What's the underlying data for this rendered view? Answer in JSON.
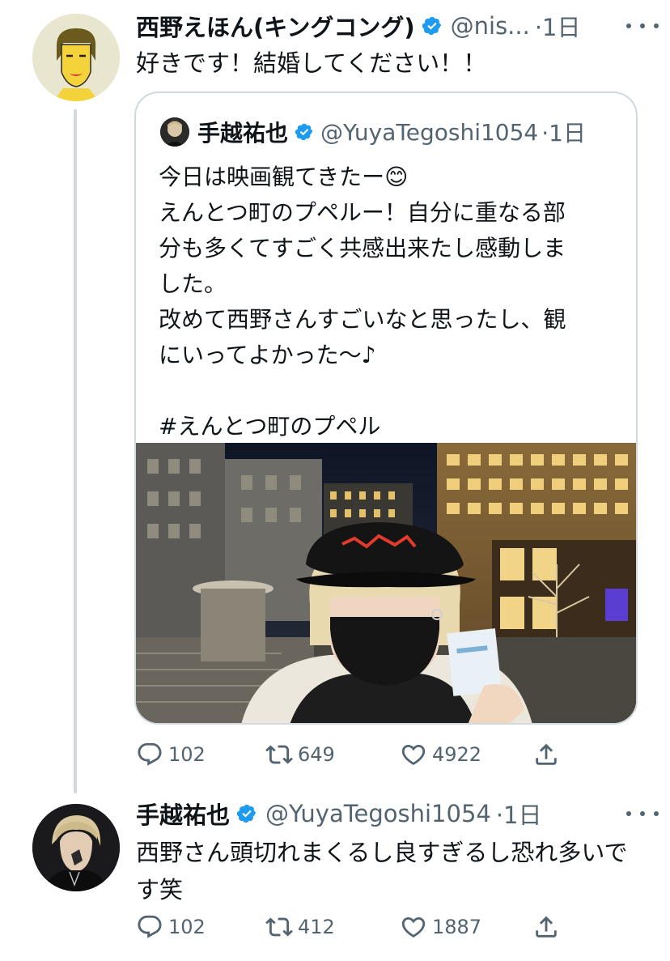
{
  "tweets": [
    {
      "name": "西野えほん(キングコング)",
      "handle": "@nis...",
      "time": "·1日",
      "text": "好きです！結婚してください！！",
      "quote": {
        "name": "手越祐也",
        "handle": "@YuyaTegoshi1054",
        "time": "·1日",
        "text": "今日は映画観てきたー😊\nえんとつ町のプペルー！自分に重なる部\n分も多くてすごく共感出来たし感動しま\nした。\n改めて西野さんすごいなと思ったし、観\nにいってよかった〜♪\n\n#えんとつ町のプペル"
      },
      "stats": {
        "replies": "102",
        "retweets": "649",
        "likes": "4922"
      }
    },
    {
      "name": "手越祐也",
      "handle": "@YuyaTegoshi1054",
      "time": "·1日",
      "text": "西野さん頭切れまくるし良すぎるし恐れ多いです笑",
      "stats": {
        "replies": "102",
        "retweets": "412",
        "likes": "1887"
      }
    }
  ],
  "colors": {
    "text": "#0f1419",
    "secondary": "#536471",
    "verified": "#1d9bf0",
    "border": "#cfd9de"
  },
  "icons": [
    "reply-icon",
    "retweet-icon",
    "like-icon",
    "share-icon",
    "verified-icon",
    "more-icon"
  ]
}
